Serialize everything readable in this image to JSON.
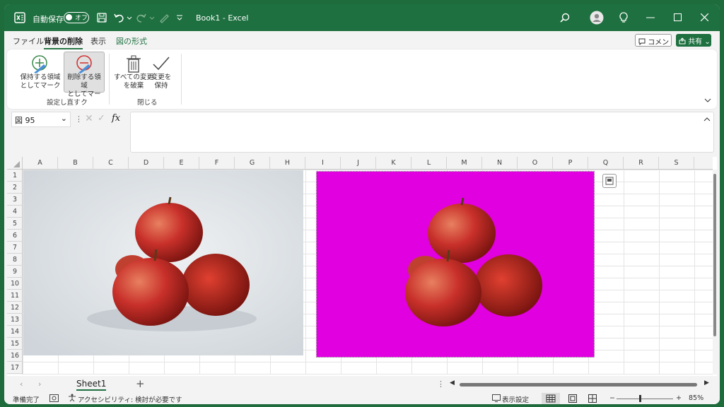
{
  "titlebar": {
    "autosave_label": "自動保存",
    "autosave_state": "オフ",
    "doc_title": "Book1 - Excel"
  },
  "menu": {
    "tabs": [
      {
        "label": "ファイル"
      },
      {
        "label": "背景の削除"
      },
      {
        "label": "表示"
      },
      {
        "label": "図の形式"
      }
    ],
    "comment_label": "コメント",
    "share_label": "共有"
  },
  "ribbon": {
    "mark_keep_line1": "保持する領域",
    "mark_keep_line2": "としてマーク",
    "mark_remove_line1": "削除する領域",
    "mark_remove_line2": "としてマーク",
    "discard_line1": "すべての変更",
    "discard_line2": "を破棄",
    "keep_line1": "変更を",
    "keep_line2": "保持",
    "group_refine": "設定し直す",
    "group_close": "閉じる"
  },
  "formula_bar": {
    "name_box": "図 95",
    "fx_label": "fx"
  },
  "grid": {
    "columns": [
      "A",
      "B",
      "C",
      "D",
      "E",
      "F",
      "G",
      "H",
      "I",
      "J",
      "K",
      "L",
      "M",
      "N",
      "O",
      "P",
      "Q",
      "R",
      "S"
    ],
    "rows": [
      "1",
      "2",
      "3",
      "4",
      "5",
      "6",
      "7",
      "8",
      "9",
      "10",
      "11",
      "12",
      "13",
      "14",
      "15",
      "16",
      "17"
    ]
  },
  "images": {
    "original_bg": "#d8dde2",
    "removed_bg": "#e000e0",
    "apple_color": "#c8302a"
  },
  "sheets": {
    "tabs": [
      "Sheet1"
    ],
    "add_label": "+"
  },
  "status": {
    "ready": "準備完了",
    "accessibility": "アクセシビリティ: 検討が必要です",
    "display_settings": "表示設定",
    "zoom": "85%",
    "zoom_minus": "−",
    "zoom_plus": "+"
  }
}
